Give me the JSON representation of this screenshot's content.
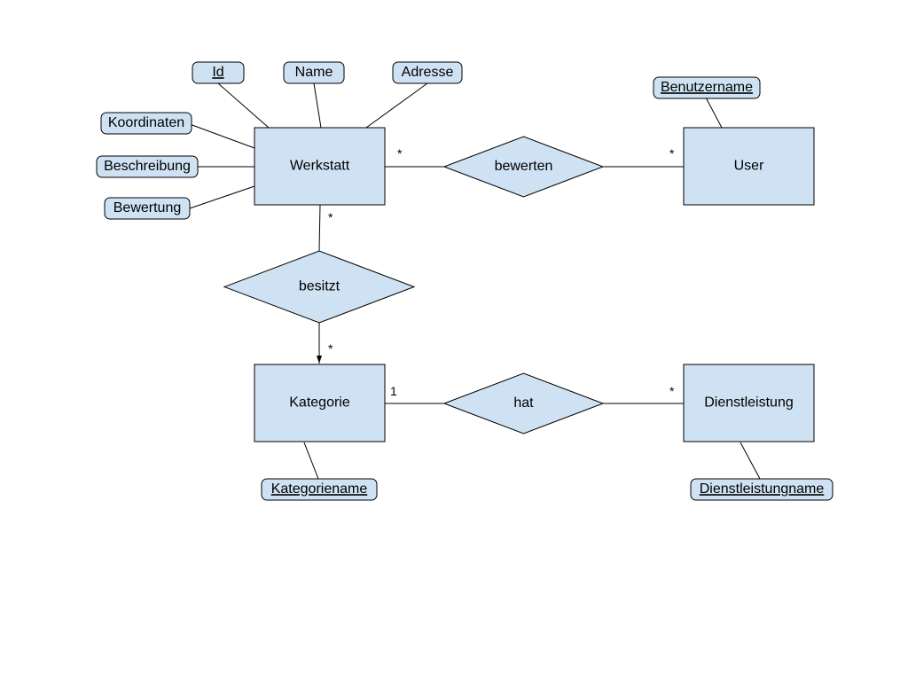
{
  "diagram": {
    "type": "entity-relationship",
    "entities": {
      "werkstatt": {
        "label": "Werkstatt"
      },
      "user": {
        "label": "User"
      },
      "kategorie": {
        "label": "Kategorie"
      },
      "dienstleistung": {
        "label": "Dienstleistung"
      }
    },
    "relationships": {
      "bewerten": {
        "label": "bewerten"
      },
      "besitzt": {
        "label": "besitzt"
      },
      "hat": {
        "label": "hat"
      }
    },
    "attributes": {
      "id": {
        "label": "Id",
        "key": true
      },
      "name": {
        "label": "Name"
      },
      "adresse": {
        "label": "Adresse"
      },
      "koordinaten": {
        "label": "Koordinaten"
      },
      "beschreibung": {
        "label": "Beschreibung"
      },
      "bewertung": {
        "label": "Bewertung"
      },
      "benutzername": {
        "label": "Benutzername",
        "key": true
      },
      "kategoriename": {
        "label": "Kategoriename",
        "key": true
      },
      "dienstleistungname": {
        "label": "Dienstleistungname",
        "key": true
      }
    },
    "cardinalities": {
      "werkstatt_bewerten": "*",
      "user_bewerten": "*",
      "werkstatt_besitzt": "*",
      "kategorie_besitzt": "*",
      "kategorie_hat": "1",
      "dienstleistung_hat": "*"
    }
  }
}
